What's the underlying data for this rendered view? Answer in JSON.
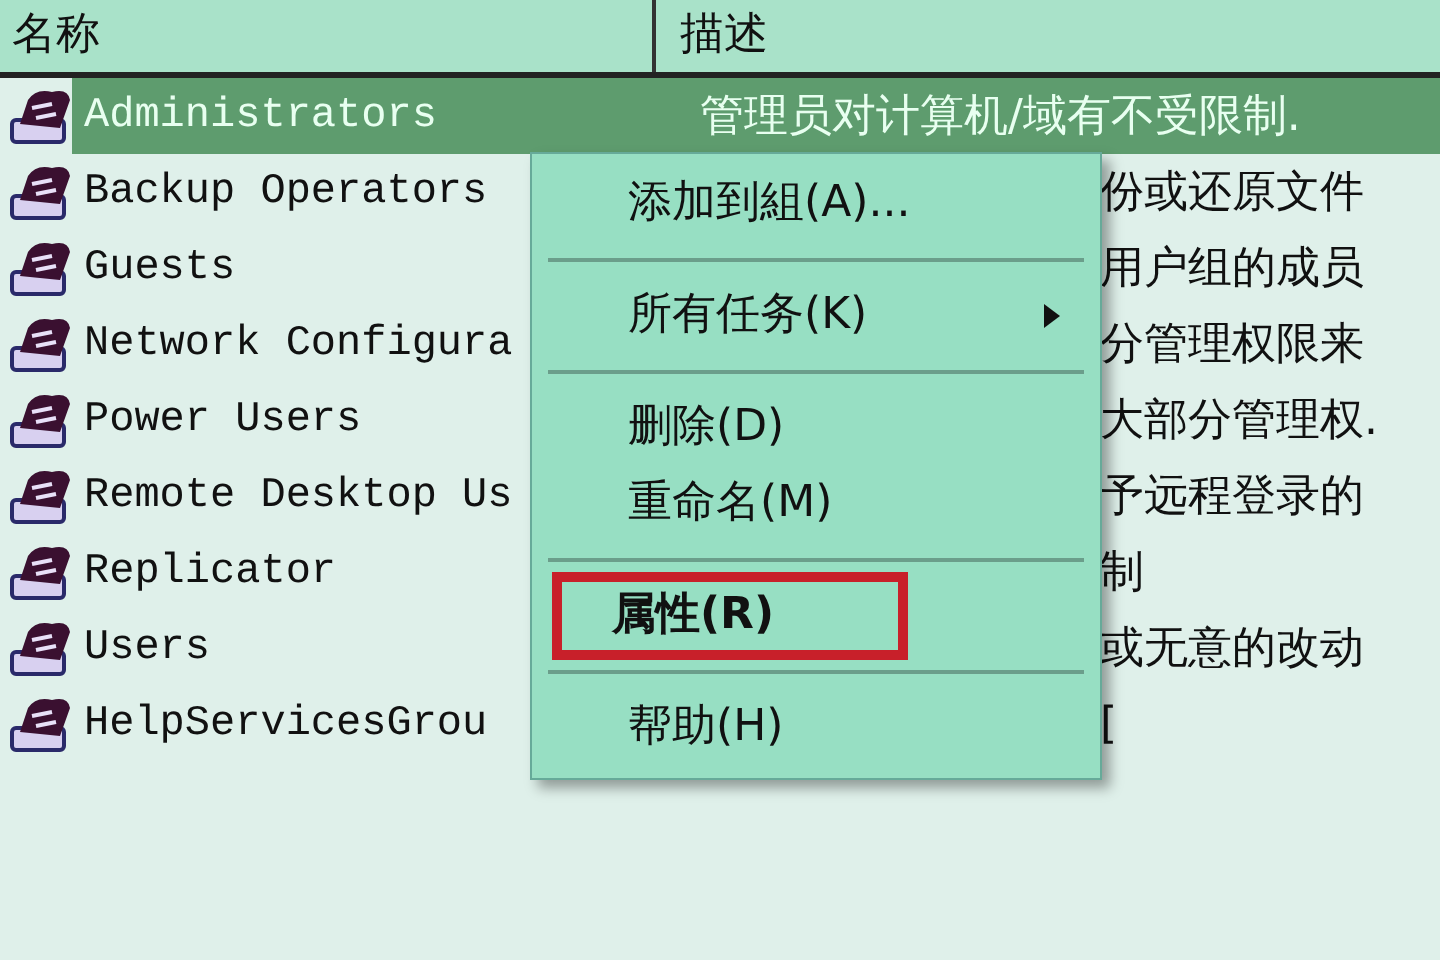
{
  "table": {
    "columns": [
      "名称",
      "描述"
    ],
    "rows": [
      {
        "name": "Administrators",
        "description": "管理员对计算机/域有不受限制.",
        "selected": true
      },
      {
        "name": "Backup Operators",
        "description": "份或还原文件",
        "selected": false
      },
      {
        "name": "Guests",
        "description": "用户组的成员",
        "selected": false
      },
      {
        "name": "Network Configura",
        "description": "分管理权限来",
        "selected": false
      },
      {
        "name": "Power Users",
        "description": "大部分管理权.",
        "selected": false
      },
      {
        "name": "Remote Desktop Us",
        "description": "予远程登录的",
        "selected": false
      },
      {
        "name": "Replicator",
        "description": "制",
        "selected": false
      },
      {
        "name": "Users",
        "description": "或无意的改动",
        "selected": false
      },
      {
        "name": "HelpServicesGrou",
        "description": "[",
        "selected": false
      }
    ]
  },
  "context_menu": {
    "items": [
      {
        "kind": "item",
        "label": "添加到組(A)...",
        "submenu": false,
        "default": false,
        "highlighted": false
      },
      {
        "kind": "separator"
      },
      {
        "kind": "item",
        "label": "所有任务(K)",
        "submenu": true,
        "default": false,
        "highlighted": false
      },
      {
        "kind": "separator"
      },
      {
        "kind": "item",
        "label": "删除(D)",
        "submenu": false,
        "default": false,
        "highlighted": false
      },
      {
        "kind": "item",
        "label": "重命名(M)",
        "submenu": false,
        "default": false,
        "highlighted": false
      },
      {
        "kind": "separator"
      },
      {
        "kind": "item",
        "label": "属性(R)",
        "submenu": false,
        "default": true,
        "highlighted": true
      },
      {
        "kind": "separator"
      },
      {
        "kind": "item",
        "label": "帮助(H)",
        "submenu": false,
        "default": false,
        "highlighted": false
      }
    ]
  }
}
